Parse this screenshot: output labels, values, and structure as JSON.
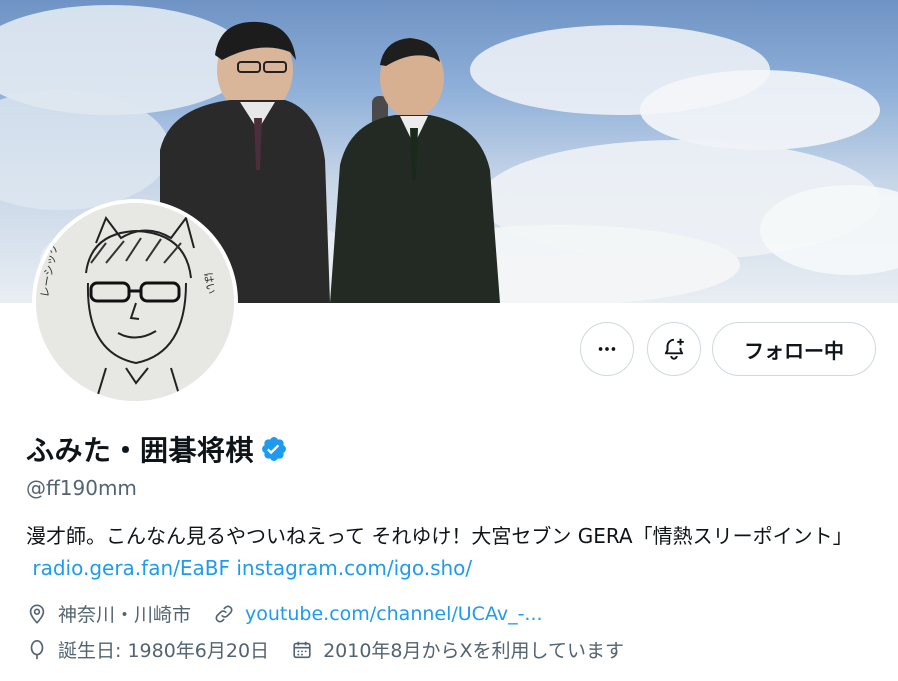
{
  "profile": {
    "display_name": "ふみた・囲碁将棋",
    "handle": "@ff190mm",
    "bio_text": "漫才師。こんなん見るやつ​いねえって それゆけ！大宮セブン GERA「情熱スリーポイント」",
    "bio_link1": "radio.gera.fan/EaBF",
    "bio_link2": "instagram.com/igo.sho/",
    "location": "神奈川・川崎市",
    "website": "youtube.com/channel/UCAv_-...",
    "birthday": "誕生日: 1980年6月20日",
    "joined": "2010年8月からXを利用しています"
  },
  "actions": {
    "follow_label": "フォロー中"
  },
  "icons": {
    "more": "more-horizontal-icon",
    "notify": "bell-plus-icon",
    "verified": "verified-badge-icon",
    "location": "location-pin-icon",
    "link": "link-icon",
    "birthday": "balloon-icon",
    "calendar": "calendar-icon"
  },
  "colors": {
    "accent": "#1d9bf0",
    "secondary_text": "#536471",
    "border": "#cfd9de"
  }
}
